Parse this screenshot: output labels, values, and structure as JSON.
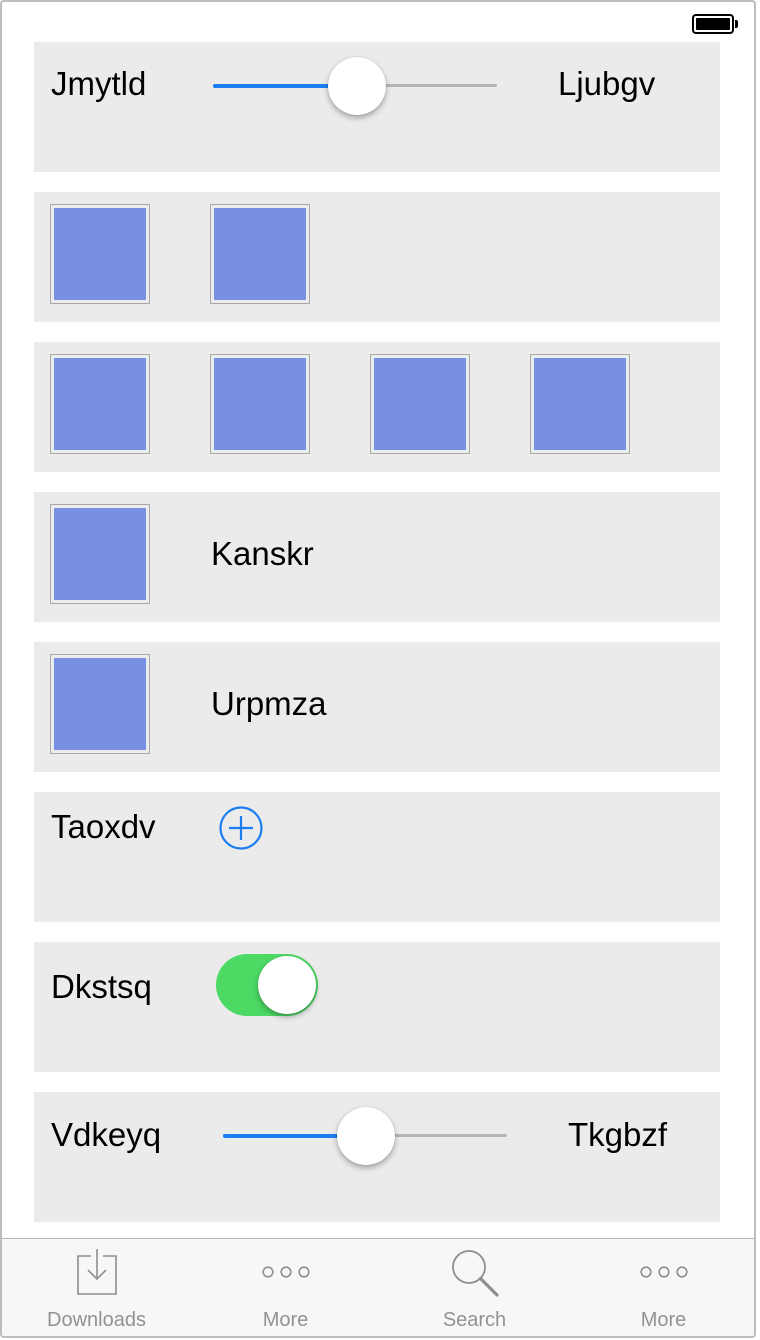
{
  "status_bar": {
    "battery_icon": "battery-full-icon"
  },
  "rows": {
    "slider1": {
      "left_label": "Jmytld",
      "right_label": "Ljubgv",
      "value": 0.5
    },
    "image_row2": {
      "count": 2
    },
    "image_row4": {
      "count": 4
    },
    "image_text1": {
      "label": "Kanskr"
    },
    "image_text2": {
      "label": "Urpmza"
    },
    "add_row": {
      "label": "Taoxdv",
      "icon": "plus-circle-icon"
    },
    "toggle_row": {
      "label": "Dkstsq",
      "on": true
    },
    "slider2": {
      "left_label": "Vdkeyq",
      "right_label": "Tkgbzf",
      "value": 0.5
    }
  },
  "tab_bar": {
    "items": [
      {
        "label": "Downloads",
        "icon": "downloads-icon"
      },
      {
        "label": "More",
        "icon": "more-icon"
      },
      {
        "label": "Search",
        "icon": "search-icon"
      },
      {
        "label": "More",
        "icon": "more-icon"
      }
    ]
  },
  "colors": {
    "accent": "#1a7ef2",
    "toggle_on": "#4cd964",
    "row_bg": "#ebebeb",
    "image_fill": "#7890e4",
    "tab_label": "#929292"
  }
}
